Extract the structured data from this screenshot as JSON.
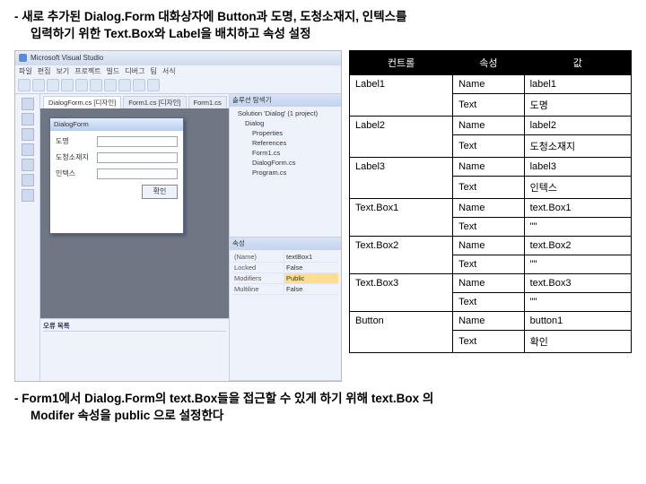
{
  "desc_line1": "- 새로 추가된 Dialog.Form 대화상자에 Button과 도명, 도청소재지, 인텍스를",
  "desc_line2_indent": "입력하기 위한 Text.Box와 Label을 배치하고 속성 설정",
  "table": {
    "headers": {
      "control": "컨트롤",
      "property": "속성",
      "value": "값"
    },
    "rows": [
      {
        "control": "Label1",
        "props": [
          {
            "p": "Name",
            "v": "label1"
          },
          {
            "p": "Text",
            "v": "도명"
          }
        ]
      },
      {
        "control": "Label2",
        "props": [
          {
            "p": "Name",
            "v": "label2"
          },
          {
            "p": "Text",
            "v": "도청소재지"
          }
        ]
      },
      {
        "control": "Label3",
        "props": [
          {
            "p": "Name",
            "v": "label3"
          },
          {
            "p": "Text",
            "v": "인텍스"
          }
        ]
      },
      {
        "control": "Text.Box1",
        "props": [
          {
            "p": "Name",
            "v": "text.Box1"
          },
          {
            "p": "Text",
            "v": "\"\""
          }
        ]
      },
      {
        "control": "Text.Box2",
        "props": [
          {
            "p": "Name",
            "v": "text.Box2"
          },
          {
            "p": "Text",
            "v": "\"\""
          }
        ]
      },
      {
        "control": "Text.Box3",
        "props": [
          {
            "p": "Name",
            "v": "text.Box3"
          },
          {
            "p": "Text",
            "v": "\"\""
          }
        ]
      },
      {
        "control": "Button",
        "props": [
          {
            "p": "Name",
            "v": "button1"
          },
          {
            "p": "Text",
            "v": "확인"
          }
        ]
      }
    ]
  },
  "vs": {
    "title": "Microsoft Visual Studio",
    "menus": [
      "파일",
      "편집",
      "보기",
      "프로젝트",
      "빌드",
      "디버그",
      "팀",
      "서식"
    ],
    "tabs": [
      "DialogForm.cs [디자인]",
      "Form1.cs [디자인]",
      "Form1.cs"
    ],
    "form_title": "DialogForm",
    "df_labels": {
      "l1": "도명",
      "l2": "도청소재지",
      "l3": "인텍스"
    },
    "df_button": "확인",
    "solution_title": "솔루션 탐색기",
    "solution_items": {
      "sln": "Solution 'Dialog' (1 project)",
      "proj": "Dialog",
      "props": "Properties",
      "refs": "References",
      "f1": "Form1.cs",
      "f2": "DialogForm.cs",
      "prog": "Program.cs"
    },
    "props_title": "속성",
    "prop_rows": [
      {
        "n": "(Name)",
        "v": "textBox1",
        "hl": false
      },
      {
        "n": "Locked",
        "v": "False",
        "hl": false
      },
      {
        "n": "Modifiers",
        "v": "Public",
        "hl": true
      },
      {
        "n": "Multiline",
        "v": "False",
        "hl": false
      }
    ],
    "bottom_panel_title": "오류 목록"
  },
  "bottom_line1": "- Form1에서 Dialog.Form의 text.Box들을 접근할 수 있게 하기 위해 text.Box 의",
  "bottom_line2": "Modifer 속성을 public 으로 설정한다"
}
